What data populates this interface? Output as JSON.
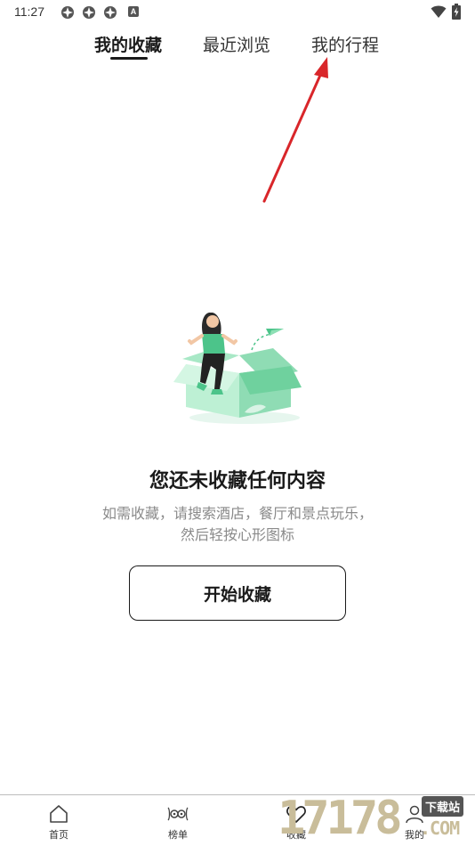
{
  "status_bar": {
    "time": "11:27",
    "icons": [
      "app-notification-icon",
      "app-notification-icon",
      "app-notification-icon",
      "a-badge-icon",
      "wifi-icon",
      "battery-charging-icon"
    ],
    "a_badge_text": "A"
  },
  "tabs": [
    {
      "label": "我的收藏",
      "active": true
    },
    {
      "label": "最近浏览",
      "active": false
    },
    {
      "label": "我的行程",
      "active": false
    }
  ],
  "annotation": {
    "color": "#d9262a"
  },
  "empty_state": {
    "title": "您还未收藏任何内容",
    "description_line1": "如需收藏，请搜索酒店，餐厅和景点玩乐，",
    "description_line2": "然后轻按心形图标",
    "button_label": "开始收藏"
  },
  "bottom_nav": [
    {
      "label": "首页",
      "icon": "home-icon"
    },
    {
      "label": "榜单",
      "icon": "ranking-owl-icon"
    },
    {
      "label": "收藏",
      "icon": "heart-icon",
      "active": true
    },
    {
      "label": "我的",
      "icon": "profile-icon"
    }
  ],
  "watermark": {
    "number": "17178",
    "badge": "下载站",
    "suffix": ".COM"
  },
  "colors": {
    "accent_green": "#4cc48a",
    "text_primary": "#1a1a1a",
    "text_secondary": "#8a8a8a",
    "arrow_red": "#d9262a",
    "watermark_gold": "#c9bd9a"
  }
}
